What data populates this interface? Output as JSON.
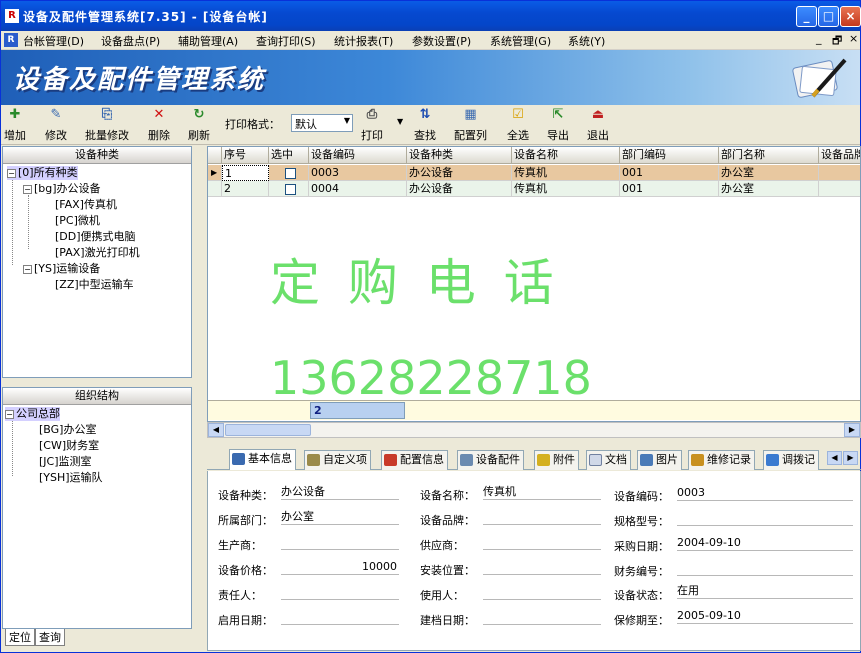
{
  "window": {
    "title": "设备及配件管理系统[7.35] - [设备台帐]"
  },
  "menu": [
    "台帐管理(D)",
    "设备盘点(P)",
    "辅助管理(A)",
    "查询打印(S)",
    "统计报表(T)",
    "参数设置(P)",
    "系统管理(G)",
    "系统(Y)"
  ],
  "banner": {
    "title": "设备及配件管理系统"
  },
  "toolbar": {
    "add": "增加",
    "edit": "修改",
    "batch_edit": "批量修改",
    "delete": "删除",
    "refresh": "刷新",
    "print_format_label": "打印格式：",
    "print_format_value": "默认",
    "print": "打印",
    "find": "查找",
    "config_cols": "配置列",
    "select_all": "全选",
    "export": "导出",
    "exit": "退出"
  },
  "device_type_panel": {
    "header": "设备种类",
    "nodes": [
      "[0]所有种类",
      "[bg]办公设备",
      "[FAX]传真机",
      "[PC]微机",
      "[DD]便携式电脑",
      "[PAX]激光打印机",
      "[YS]运输设备",
      "[ZZ]中型运输车"
    ]
  },
  "org_panel": {
    "header": "组织结构",
    "nodes": [
      "公司总部",
      "[BG]办公室",
      "[CW]财务室",
      "[JC]监测室",
      "[YSH]运输队"
    ]
  },
  "left_tabs": [
    "定位",
    "查询"
  ],
  "grid": {
    "columns": [
      "序号",
      "选中",
      "设备编码",
      "设备种类",
      "设备名称",
      "部门编码",
      "部门名称",
      "设备品牌"
    ],
    "rows": [
      {
        "no": "1",
        "code": "0003",
        "type": "办公设备",
        "name": "传真机",
        "dept_code": "001",
        "dept_name": "办公室"
      },
      {
        "no": "2",
        "code": "0004",
        "type": "办公设备",
        "name": "传真机",
        "dept_code": "001",
        "dept_name": "办公室"
      }
    ],
    "total_count": "2"
  },
  "watermark": {
    "line1": "定 购 电 话",
    "line2": "13628228718"
  },
  "detail_tabs": [
    "基本信息",
    "自定义项",
    "配置信息",
    "设备配件",
    "附件",
    "文档",
    "图片",
    "维修记录",
    "调拨记"
  ],
  "detail": {
    "device_type_label": "设备种类：",
    "device_type": "办公设备",
    "device_name_label": "设备名称：",
    "device_name": "传真机",
    "device_code_label": "设备编码：",
    "device_code": "0003",
    "dept_label": "所属部门：",
    "dept": "办公室",
    "brand_label": "设备品牌：",
    "brand": "",
    "model_label": "规格型号：",
    "model": "",
    "maker_label": "生产商：",
    "maker": "",
    "supplier_label": "供应商：",
    "supplier": "",
    "purchase_date_label": "采购日期：",
    "purchase_date": "2004-09-10",
    "price_label": "设备价格：",
    "price": "10000",
    "install_label": "安装位置：",
    "install": "",
    "finance_no_label": "财务编号：",
    "finance_no": "",
    "owner_label": "责任人：",
    "owner": "",
    "user_label": "使用人：",
    "user": "",
    "status_label": "设备状态：",
    "status": "在用",
    "start_date_label": "启用日期：",
    "start_date": "",
    "file_date_label": "建档日期：",
    "file_date": "",
    "warranty_label": "保修期至：",
    "warranty": "2005-09-10"
  }
}
